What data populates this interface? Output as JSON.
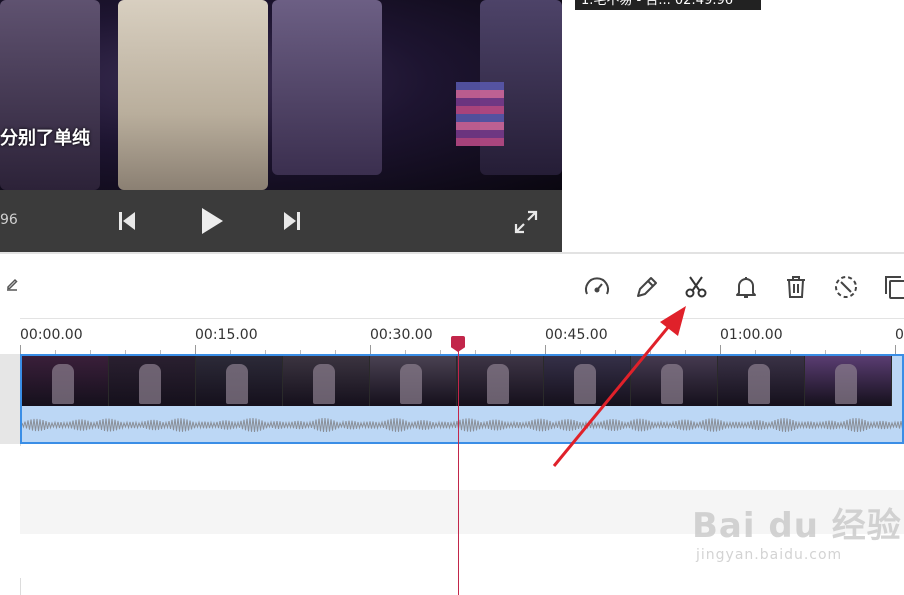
{
  "player": {
    "subtitle": "分别了单纯",
    "time_left": "96",
    "clip_label": "1.毛不易 - 否...  02:49.96"
  },
  "icons": {
    "prev": "skip-back-icon",
    "play": "play-icon",
    "next": "skip-forward-icon",
    "fullscreen": "fullscreen-icon",
    "edit_small": "pencil-small-icon"
  },
  "toolbar": {
    "tools": [
      "speed-icon",
      "pencil-icon",
      "scissors-icon",
      "bell-icon",
      "trash-icon",
      "crop-rotate-icon",
      "copy-icon"
    ]
  },
  "timeline": {
    "ticks": [
      "00:00.00",
      "00:15.00",
      "00:30.00",
      "00:45.00",
      "01:00.00",
      "0"
    ]
  },
  "watermark": {
    "brand": "Bai du 经验",
    "site": "jingyan.baidu.com"
  },
  "colors": {
    "accent": "#3a8ee6",
    "playhead": "#c2264a",
    "arrow": "#e0212a"
  }
}
